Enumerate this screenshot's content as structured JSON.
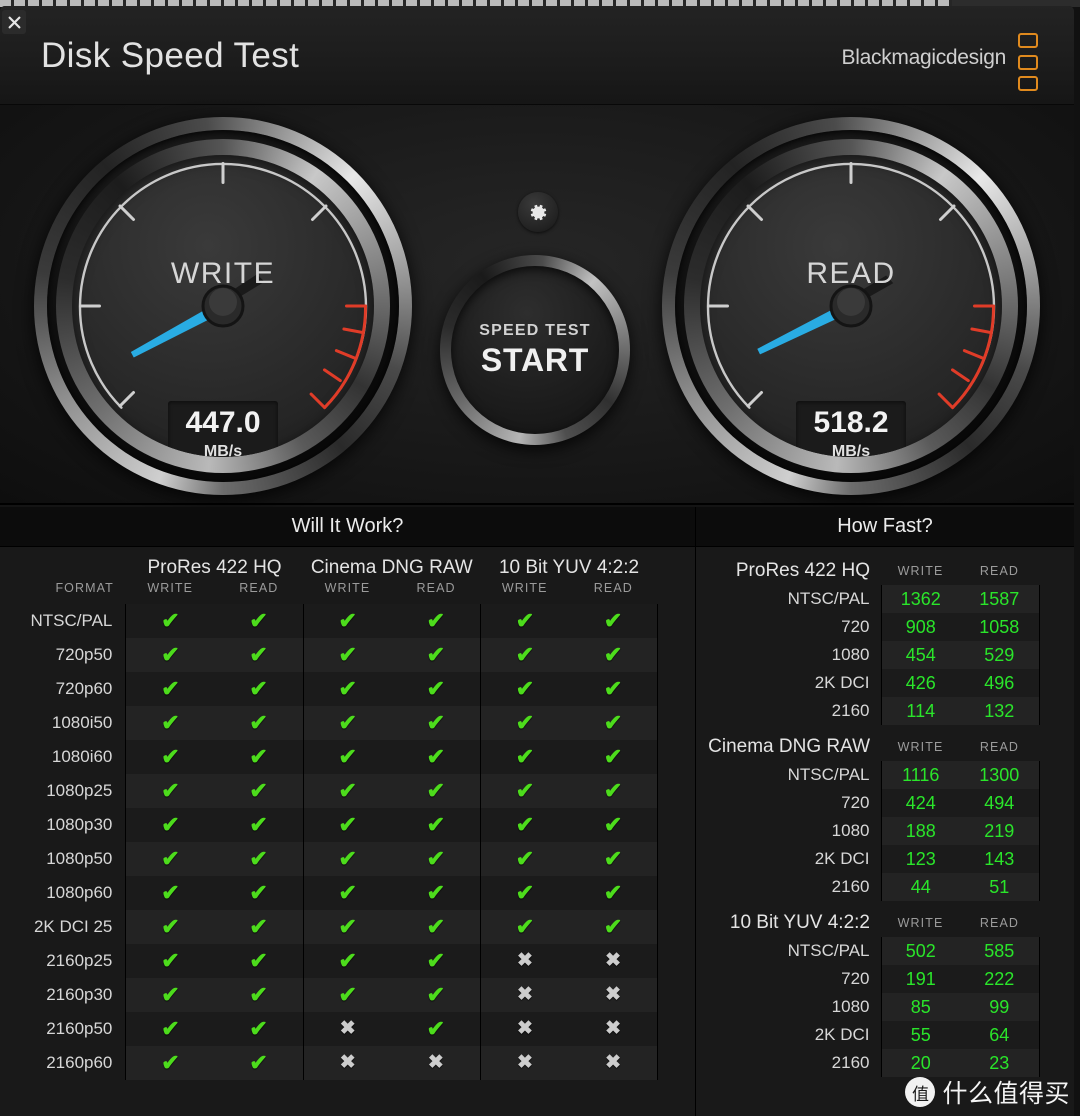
{
  "window": {
    "title": "Disk Speed Test",
    "brand": "Blackmagicdesign",
    "close_icon": "close-icon"
  },
  "gauges": {
    "write": {
      "label": "WRITE",
      "value": "447.0",
      "unit": "MB/s",
      "needle_deg": -28,
      "max": 1000
    },
    "read": {
      "label": "READ",
      "value": "518.2",
      "unit": "MB/s",
      "needle_deg": -26,
      "max": 1000
    }
  },
  "controls": {
    "gear_icon": "gear-icon",
    "start_line1": "SPEED TEST",
    "start_line2": "START"
  },
  "will_it_work": {
    "title": "Will It Work?",
    "format_header": "FORMAT",
    "groups": [
      {
        "name": "ProRes 422 HQ",
        "cols": [
          "WRITE",
          "READ"
        ]
      },
      {
        "name": "Cinema DNG RAW",
        "cols": [
          "WRITE",
          "READ"
        ]
      },
      {
        "name": "10 Bit YUV 4:2:2",
        "cols": [
          "WRITE",
          "READ"
        ]
      }
    ],
    "yes_glyph": "✔",
    "no_glyph": "✖",
    "rows": [
      {
        "format": "NTSC/PAL",
        "cells": [
          true,
          true,
          true,
          true,
          true,
          true
        ]
      },
      {
        "format": "720p50",
        "cells": [
          true,
          true,
          true,
          true,
          true,
          true
        ]
      },
      {
        "format": "720p60",
        "cells": [
          true,
          true,
          true,
          true,
          true,
          true
        ]
      },
      {
        "format": "1080i50",
        "cells": [
          true,
          true,
          true,
          true,
          true,
          true
        ]
      },
      {
        "format": "1080i60",
        "cells": [
          true,
          true,
          true,
          true,
          true,
          true
        ]
      },
      {
        "format": "1080p25",
        "cells": [
          true,
          true,
          true,
          true,
          true,
          true
        ]
      },
      {
        "format": "1080p30",
        "cells": [
          true,
          true,
          true,
          true,
          true,
          true
        ]
      },
      {
        "format": "1080p50",
        "cells": [
          true,
          true,
          true,
          true,
          true,
          true
        ]
      },
      {
        "format": "1080p60",
        "cells": [
          true,
          true,
          true,
          true,
          true,
          true
        ]
      },
      {
        "format": "2K DCI 25",
        "cells": [
          true,
          true,
          true,
          true,
          true,
          true
        ]
      },
      {
        "format": "2160p25",
        "cells": [
          true,
          true,
          true,
          true,
          false,
          false
        ]
      },
      {
        "format": "2160p30",
        "cells": [
          true,
          true,
          true,
          true,
          false,
          false
        ]
      },
      {
        "format": "2160p50",
        "cells": [
          true,
          true,
          false,
          true,
          false,
          false
        ]
      },
      {
        "format": "2160p60",
        "cells": [
          true,
          true,
          false,
          false,
          false,
          false
        ]
      }
    ]
  },
  "how_fast": {
    "title": "How Fast?",
    "write_header": "WRITE",
    "read_header": "READ",
    "sections": [
      {
        "name": "ProRes 422 HQ",
        "rows": [
          {
            "res": "NTSC/PAL",
            "write": "1362",
            "read": "1587"
          },
          {
            "res": "720",
            "write": "908",
            "read": "1058"
          },
          {
            "res": "1080",
            "write": "454",
            "read": "529"
          },
          {
            "res": "2K DCI",
            "write": "426",
            "read": "496"
          },
          {
            "res": "2160",
            "write": "114",
            "read": "132"
          }
        ]
      },
      {
        "name": "Cinema DNG RAW",
        "rows": [
          {
            "res": "NTSC/PAL",
            "write": "1116",
            "read": "1300"
          },
          {
            "res": "720",
            "write": "424",
            "read": "494"
          },
          {
            "res": "1080",
            "write": "188",
            "read": "219"
          },
          {
            "res": "2K DCI",
            "write": "123",
            "read": "143"
          },
          {
            "res": "2160",
            "write": "44",
            "read": "51"
          }
        ]
      },
      {
        "name": "10 Bit YUV 4:2:2",
        "rows": [
          {
            "res": "NTSC/PAL",
            "write": "502",
            "read": "585"
          },
          {
            "res": "720",
            "write": "191",
            "read": "222"
          },
          {
            "res": "1080",
            "write": "85",
            "read": "99"
          },
          {
            "res": "2K DCI",
            "write": "55",
            "read": "64"
          },
          {
            "res": "2160",
            "write": "20",
            "read": "23"
          }
        ]
      }
    ]
  },
  "watermark": {
    "badge": "值",
    "text": "什么值得买"
  },
  "colors": {
    "accent_green": "#2ae52a",
    "check_green": "#4ddc1c",
    "needle_blue": "#29ace3",
    "redzone": "#e03c28",
    "brand_orange": "#e08a1e"
  }
}
